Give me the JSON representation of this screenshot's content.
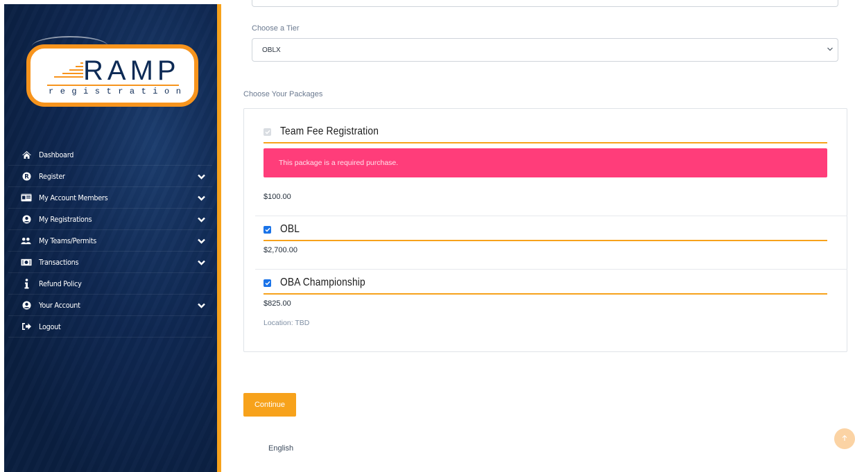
{
  "brand": {
    "logo_main": "RAMP",
    "logo_sub": "registration",
    "accent_color": "#f7a21b",
    "sidebar_color": "#0c2248"
  },
  "sidebar": {
    "items": [
      {
        "label": "Dashboard",
        "icon": "home-icon",
        "has_chevron": false
      },
      {
        "label": "Register",
        "icon": "registered-icon",
        "has_chevron": true
      },
      {
        "label": "My Account Members",
        "icon": "id-card-icon",
        "has_chevron": true
      },
      {
        "label": "My Registrations",
        "icon": "user-circle-icon",
        "has_chevron": true
      },
      {
        "label": "My Teams/Permits",
        "icon": "users-icon",
        "has_chevron": true
      },
      {
        "label": "Transactions",
        "icon": "money-icon",
        "has_chevron": true
      },
      {
        "label": "Refund Policy",
        "icon": "info-icon",
        "has_chevron": false
      },
      {
        "label": "Your Account",
        "icon": "user-circle-icon",
        "has_chevron": true
      },
      {
        "label": "Logout",
        "icon": "logout-icon",
        "has_chevron": false
      }
    ]
  },
  "form": {
    "tier_label": "Choose a Tier",
    "tier_value": "OBLX",
    "packages_label": "Choose Your Packages"
  },
  "packages": [
    {
      "title": "Team Fee Registration",
      "checked": true,
      "disabled": true,
      "alert": "This package is a required purchase.",
      "price": "$100.00"
    },
    {
      "title": "OBL",
      "checked": true,
      "disabled": false,
      "price": "$2,700.00"
    },
    {
      "title": "OBA Championship",
      "checked": true,
      "disabled": false,
      "price": "$825.00",
      "location": "Location: TBD"
    }
  ],
  "actions": {
    "continue_label": "Continue"
  },
  "footer": {
    "language": "English"
  }
}
